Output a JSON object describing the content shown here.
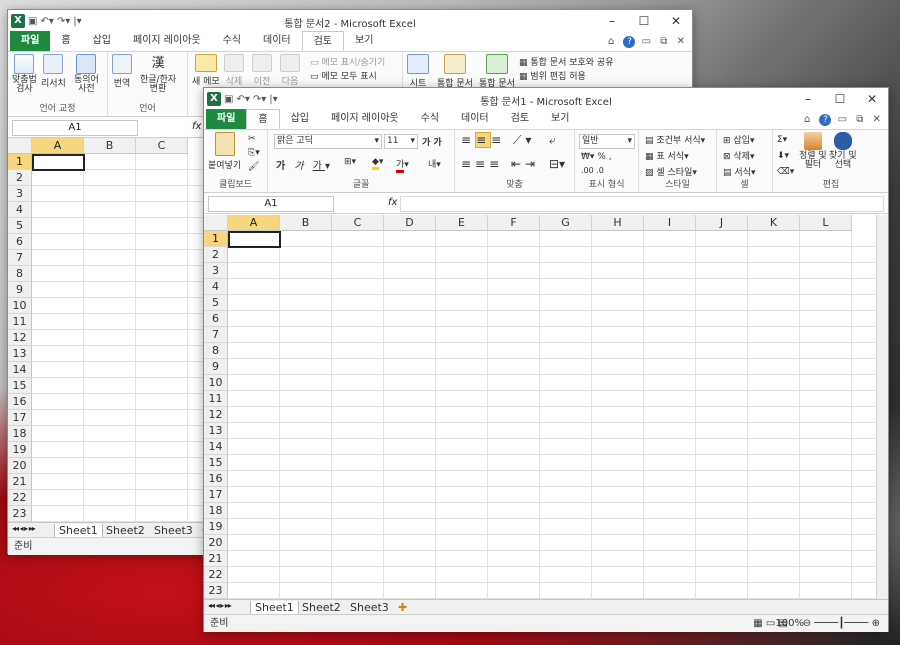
{
  "back": {
    "title": "통합 문서2 - Microsoft Excel",
    "tabs": [
      "파일",
      "홈",
      "삽입",
      "페이지 레이아웃",
      "수식",
      "데이터",
      "검토",
      "보기"
    ],
    "active_tab": "검토",
    "ribbon": {
      "spell": "맞춤법\n검사",
      "research": "리서치",
      "thesaurus": "동의어\n사전",
      "translate": "번역",
      "hanja": "한글/한자\n변환",
      "new_comment": "새 메모",
      "delete": "삭제",
      "prev": "이전",
      "next": "다음",
      "show_hide_comment": "메모 표시/숨기기",
      "show_all_comments": "메모 모두 표시",
      "protect_sheet": "시트",
      "protect_workbook": "통합 문서",
      "share_workbook": "통합 문서",
      "protect_share": "통합 문서 보호와 공유",
      "allow_edit": "범위 편집 허용",
      "group_proofing": "언어 교정",
      "group_language": "언어"
    },
    "namebox": "A1",
    "fx": "fx",
    "columns": [
      "A",
      "B",
      "C"
    ],
    "rows": [
      "1",
      "2",
      "3",
      "4",
      "5",
      "6",
      "7",
      "8",
      "9",
      "10",
      "11",
      "12",
      "13",
      "14",
      "15",
      "16",
      "17",
      "18",
      "19",
      "20",
      "21",
      "22",
      "23"
    ],
    "sheets": [
      "Sheet1",
      "Sheet2",
      "Sheet3"
    ],
    "status": "준비"
  },
  "front": {
    "title": "통합 문서1 - Microsoft Excel",
    "tabs": [
      "파일",
      "홈",
      "삽입",
      "페이지 레이아웃",
      "수식",
      "데이터",
      "검토",
      "보기"
    ],
    "active_tab": "홈",
    "ribbon": {
      "paste": "붙여넣기",
      "font_name": "맑은 고딕",
      "font_size": "11",
      "number_format": "일반",
      "conditional": "조건부 서식",
      "table_format": "표 서식",
      "cell_style": "셀 스타일",
      "insert": "삽입",
      "delete": "삭제",
      "format": "서식",
      "sort_filter": "정렬 및\n필터",
      "find_select": "찾기 및\n선택",
      "groups": {
        "clipboard": "클립보드",
        "font": "글꼴",
        "align": "맞춤",
        "number": "표시 형식",
        "style": "스타일",
        "cells": "셀",
        "edit": "편집"
      }
    },
    "namebox": "A1",
    "fx": "fx",
    "columns": [
      "A",
      "B",
      "C",
      "D",
      "E",
      "F",
      "G",
      "H",
      "I",
      "J",
      "K",
      "L"
    ],
    "rows": [
      "1",
      "2",
      "3",
      "4",
      "5",
      "6",
      "7",
      "8",
      "9",
      "10",
      "11",
      "12",
      "13",
      "14",
      "15",
      "16",
      "17",
      "18",
      "19",
      "20",
      "21",
      "22",
      "23"
    ],
    "sheets": [
      "Sheet1",
      "Sheet2",
      "Sheet3"
    ],
    "status": "준비",
    "zoom": "100%"
  },
  "colors": {
    "file_tab": "#1f8a3f",
    "selected_header": "#f7d67e",
    "excel_green": "#1e7145"
  }
}
